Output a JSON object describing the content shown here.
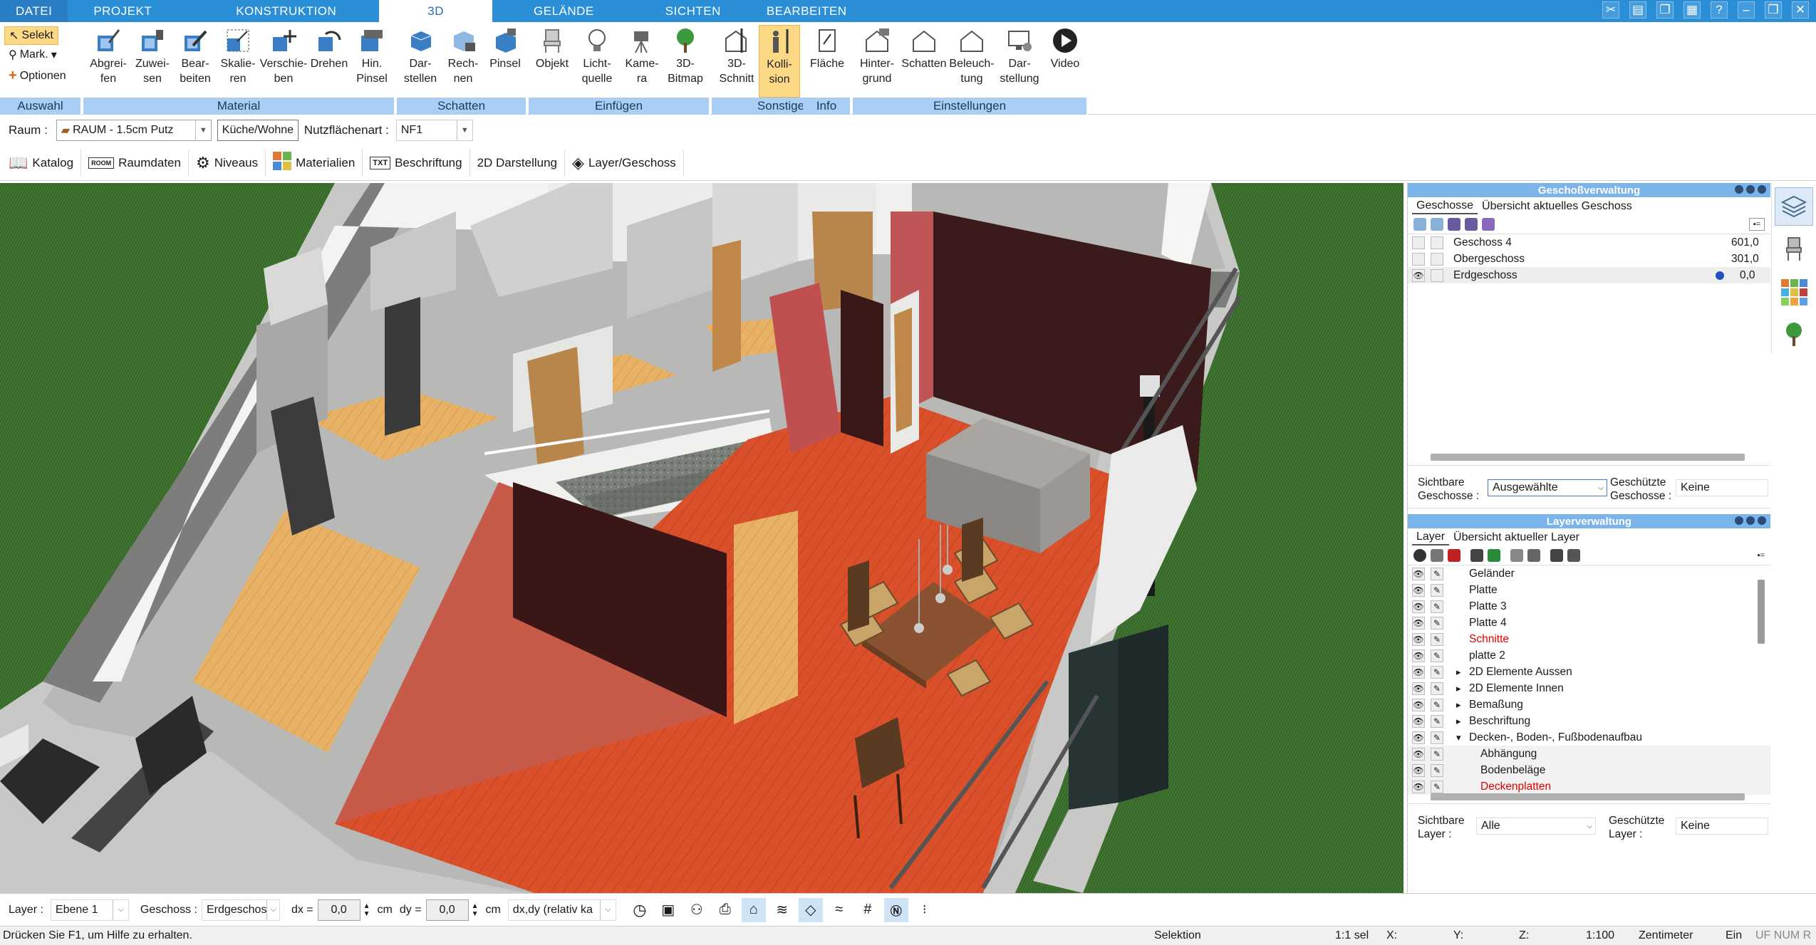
{
  "menu": {
    "tabs": [
      "DATEI",
      "PROJEKT",
      "KONSTRUKTION",
      "3D",
      "GELÄNDE",
      "SICHTEN",
      "BEARBEITEN"
    ],
    "active": "3D"
  },
  "ribbon": {
    "auswahl": {
      "label": "Auswahl",
      "select": "Selekt",
      "mark": "Mark.",
      "options": "Optionen"
    },
    "material": {
      "label": "Material",
      "buttons": [
        "Abgrei-\nfen",
        "Zuwei-\nsen",
        "Bear-\nbeiten",
        "Skalie-\nren",
        "Verschie-\nben",
        "Drehen",
        "Hin.\nPinsel"
      ]
    },
    "schatten": {
      "label": "Schatten",
      "buttons": [
        "Dar-\nstellen",
        "Rech-\nnen",
        "Pinsel"
      ]
    },
    "einfuegen": {
      "label": "Einfügen",
      "buttons": [
        "Objekt",
        "Licht-\nquelle",
        "Kame-\nra",
        "3D-\nBitmap"
      ]
    },
    "sonstige": {
      "label": "Sonstige",
      "buttons": [
        "3D-\nSchnitt",
        "Kolli-\nsion"
      ]
    },
    "info": {
      "label": "Info",
      "buttons": [
        "Fläche"
      ]
    },
    "einstellungen": {
      "label": "Einstellungen",
      "buttons": [
        "Hinter-\ngrund",
        "Schatten",
        "Beleuch-\ntung",
        "Dar-\nstellung",
        "Video"
      ]
    }
  },
  "toolbar1": {
    "raum_label": "Raum :",
    "raum_value": "RAUM - 1.5cm Putz",
    "room_name": "Küche/Wohne",
    "nutz_label": "Nutzflächenart :",
    "nutz_value": "NF1"
  },
  "toolbar2": [
    "Katalog",
    "Raumdaten",
    "Niveaus",
    "Materialien",
    "Beschriftung",
    "2D Darstellung",
    "Layer/Geschoss"
  ],
  "geschoss_panel": {
    "title": "Geschoßverwaltung",
    "tabs": [
      "Geschosse",
      "Übersicht aktuelles Geschoss"
    ],
    "rows": [
      {
        "name": "Geschoss 4",
        "value": "601,0"
      },
      {
        "name": "Obergeschoss",
        "value": "301,0"
      },
      {
        "name": "Erdgeschoss",
        "value": "0,0"
      }
    ],
    "sicht_label": "Sichtbare\nGeschosse :",
    "sicht_value": "Ausgewählte",
    "gesch_label": "Geschützte\nGeschosse :",
    "gesch_value": "Keine"
  },
  "layer_panel": {
    "title": "Layerverwaltung",
    "tabs": [
      "Layer",
      "Übersicht aktueller Layer"
    ],
    "rows": [
      {
        "name": "Geländer",
        "indent": 0,
        "red": false,
        "exp": ""
      },
      {
        "name": "Platte",
        "indent": 0,
        "red": false,
        "exp": ""
      },
      {
        "name": "Platte 3",
        "indent": 0,
        "red": false,
        "exp": ""
      },
      {
        "name": "Platte 4",
        "indent": 0,
        "red": false,
        "exp": ""
      },
      {
        "name": "Schnitte",
        "indent": 0,
        "red": true,
        "exp": ""
      },
      {
        "name": "platte 2",
        "indent": 0,
        "red": false,
        "exp": ""
      },
      {
        "name": "2D Elemente Aussen",
        "indent": 0,
        "red": false,
        "exp": "▸"
      },
      {
        "name": "2D Elemente Innen",
        "indent": 0,
        "red": false,
        "exp": "▸"
      },
      {
        "name": "Bemaßung",
        "indent": 0,
        "red": false,
        "exp": "▸"
      },
      {
        "name": "Beschriftung",
        "indent": 0,
        "red": false,
        "exp": "▸"
      },
      {
        "name": "Decken-, Boden-, Fußbodenaufbau",
        "indent": 0,
        "red": false,
        "exp": "▾"
      },
      {
        "name": "Abhängung",
        "indent": 1,
        "red": false,
        "exp": ""
      },
      {
        "name": "Bodenbeläge",
        "indent": 1,
        "red": false,
        "exp": ""
      },
      {
        "name": "Deckenplatten",
        "indent": 1,
        "red": true,
        "exp": ""
      }
    ],
    "sicht_label": "Sichtbare\nLayer :",
    "sicht_value": "Alle",
    "gesch_label": "Geschützte\nLayer :",
    "gesch_value": "Keine"
  },
  "bottombar": {
    "layer_label": "Layer :",
    "layer_value": "Ebene 1",
    "geschoss_label": "Geschoss :",
    "geschoss_value": "Erdgeschos",
    "dx_label": "dx =",
    "dx_value": "0,0",
    "dy_label": "dy =",
    "dy_value": "0,0",
    "unit": "cm",
    "mode": "dx,dy (relativ ka"
  },
  "status": {
    "hint": "Drücken Sie F1, um Hilfe zu erhalten.",
    "mode": "Selektion",
    "sel": "1:1 sel",
    "x": "X:",
    "y": "Y:",
    "z": "Z:",
    "scale": "1:100",
    "unit": "Zentimeter",
    "ein": "Ein",
    "flags": "UF  NUM  R"
  },
  "colors": {
    "accent": "#2b8fd8",
    "ribbon_group": "#a9cff4",
    "floor": "#d9502a",
    "active_btn": "#fdd986"
  }
}
